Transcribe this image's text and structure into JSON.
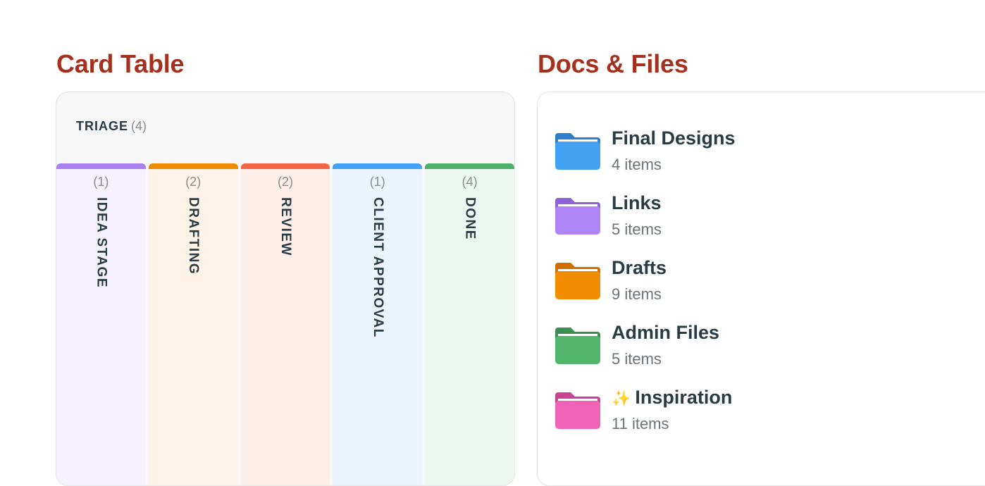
{
  "card_table": {
    "title": "Card Table",
    "triage": {
      "label": "TRIAGE",
      "count": "(4)"
    },
    "columns": [
      {
        "label": "IDEA STAGE",
        "count": "(1)",
        "accent": "#a97ff2",
        "bg": "#f5f1fd"
      },
      {
        "label": "DRAFTING",
        "count": "(2)",
        "accent": "#ed8a00",
        "bg": "#fef3e6"
      },
      {
        "label": "REVIEW",
        "count": "(2)",
        "accent": "#f26547",
        "bg": "#feeeea"
      },
      {
        "label": "CLIENT APPROVAL",
        "count": "(1)",
        "accent": "#43a1f3",
        "bg": "#ebf4fe"
      },
      {
        "label": "DONE",
        "count": "(4)",
        "accent": "#4caf6a",
        "bg": "#ecf7ef"
      }
    ]
  },
  "docs": {
    "title": "Docs & Files",
    "folders": [
      {
        "name": "Final Designs",
        "count": "4 items",
        "icon": "folder-icon-blue",
        "color": "#43a1f3",
        "tab": "#2f7fcc"
      },
      {
        "name": "Links",
        "count": "5 items",
        "icon": "folder-icon-purple",
        "color": "#b085f5",
        "tab": "#8d63d6"
      },
      {
        "name": "Drafts",
        "count": "9 items",
        "icon": "folder-icon-orange",
        "color": "#f28c00",
        "tab": "#d06e00"
      },
      {
        "name": "Admin Files",
        "count": "5 items",
        "icon": "folder-icon-green",
        "color": "#52b76c",
        "tab": "#3a8f52"
      },
      {
        "name": "Inspiration",
        "count": "11 items",
        "icon": "folder-icon-pink",
        "color": "#f063b6",
        "tab": "#c94591",
        "prefix": "✨"
      }
    ]
  }
}
